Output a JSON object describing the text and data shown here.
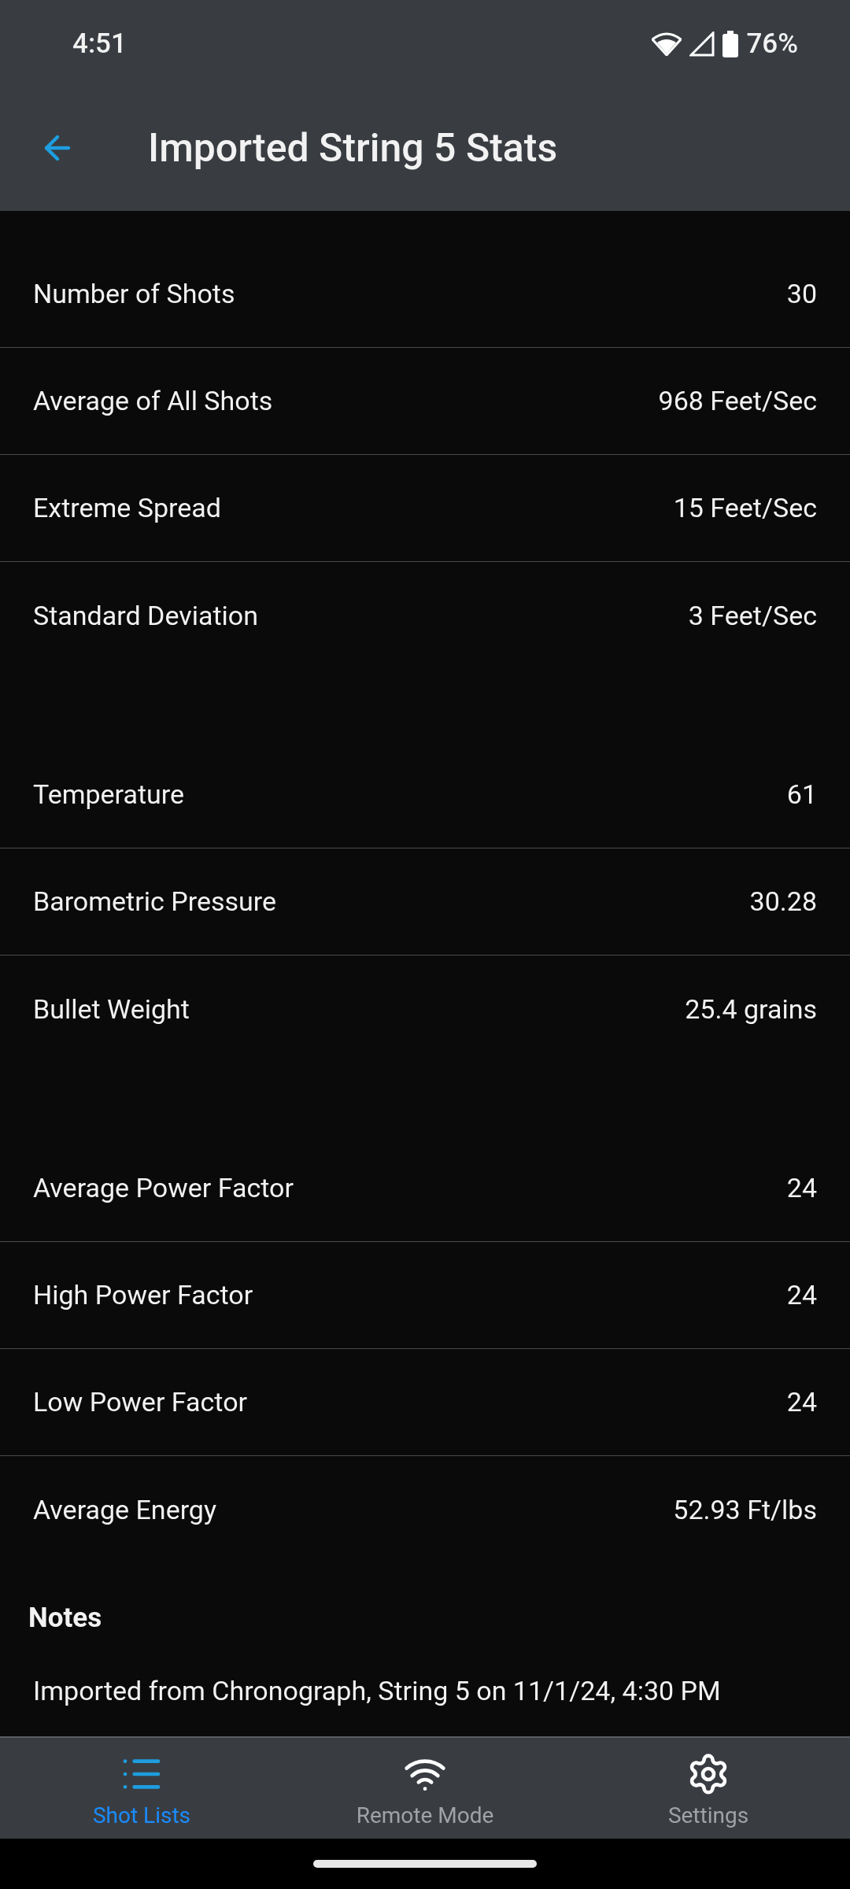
{
  "status_bar": {
    "time": "4:51",
    "battery": "76%"
  },
  "header": {
    "title": "Imported String 5 Stats"
  },
  "sections": [
    {
      "rows": [
        {
          "label": "Number of Shots",
          "value": "30"
        },
        {
          "label": "Average of All Shots",
          "value": "968 Feet/Sec"
        },
        {
          "label": "Extreme Spread",
          "value": "15 Feet/Sec"
        },
        {
          "label": "Standard Deviation",
          "value": "3 Feet/Sec"
        }
      ]
    },
    {
      "rows": [
        {
          "label": "Temperature",
          "value": "61"
        },
        {
          "label": "Barometric Pressure",
          "value": "30.28"
        },
        {
          "label": "Bullet Weight",
          "value": "25.4 grains"
        }
      ]
    },
    {
      "rows": [
        {
          "label": "Average Power Factor",
          "value": "24"
        },
        {
          "label": "High Power Factor",
          "value": "24"
        },
        {
          "label": "Low Power Factor",
          "value": "24"
        },
        {
          "label": "Average Energy",
          "value": "52.93 Ft/lbs"
        }
      ]
    }
  ],
  "notes": {
    "heading": "Notes",
    "text": "Imported from Chronograph, String 5 on 11/1/24, 4:30 PM"
  },
  "bottom_nav": [
    {
      "kind": "list",
      "label": "Shot Lists",
      "selected": true
    },
    {
      "kind": "wifi",
      "label": "Remote Mode",
      "selected": false
    },
    {
      "kind": "gear",
      "label": "Settings",
      "selected": false
    }
  ]
}
